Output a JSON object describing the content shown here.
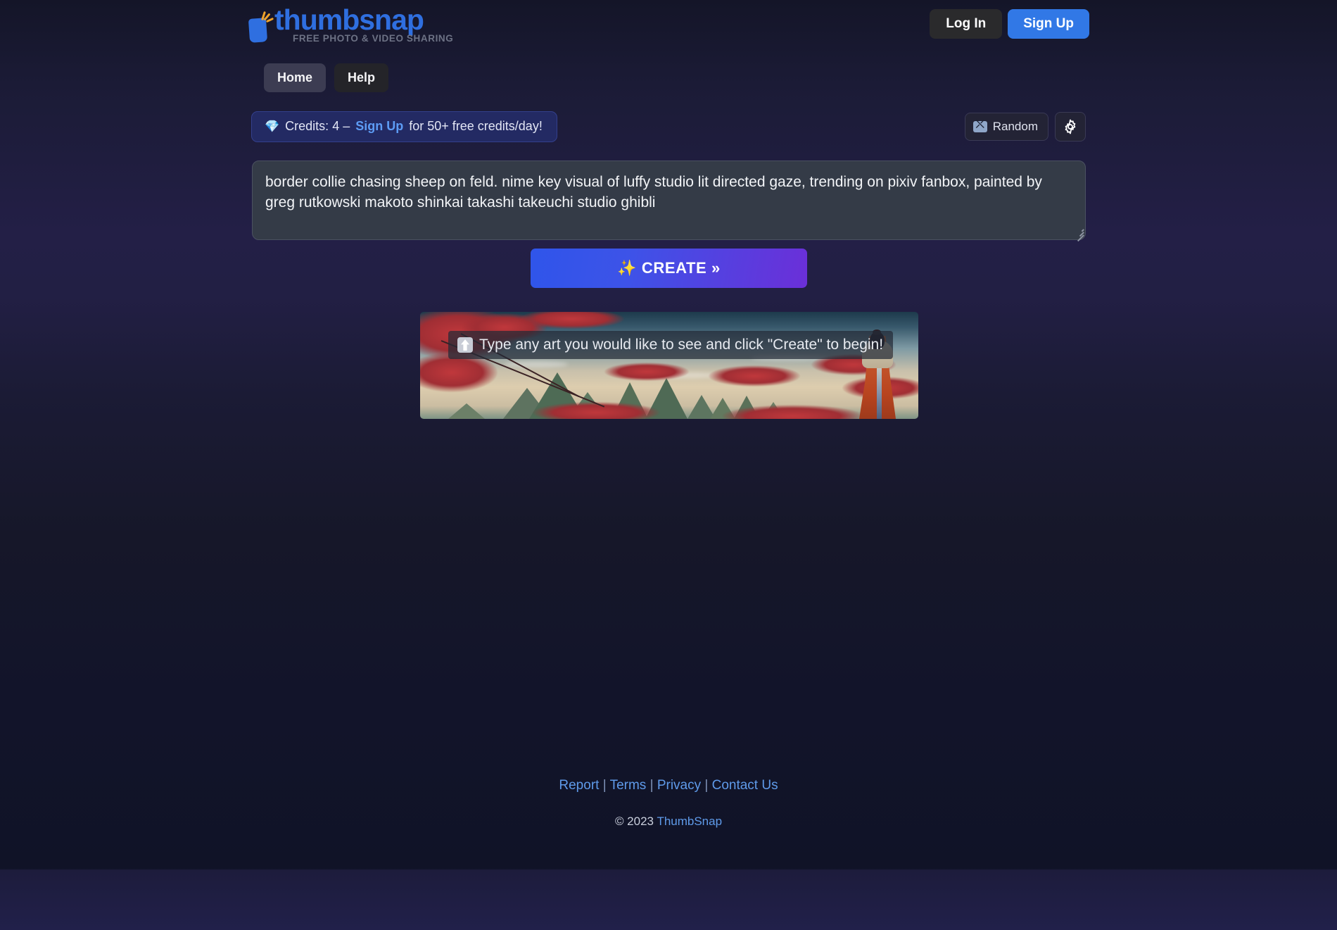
{
  "brand": {
    "name": "thumbsnap",
    "tagline": "FREE PHOTO & VIDEO SHARING",
    "logo_icon": "thumbsnap-logo-icon",
    "accent_blue": "#2f6fe0",
    "accent_orange": "#f0a32a"
  },
  "header": {
    "login_label": "Log In",
    "signup_label": "Sign Up"
  },
  "nav": {
    "items": [
      {
        "label": "Home",
        "active": true
      },
      {
        "label": "Help",
        "active": false
      }
    ]
  },
  "credits": {
    "gem_icon": "diamond-icon",
    "prefix": "Credits: 4 –",
    "signup_link": "Sign Up",
    "suffix": "for 50+ free credits/day!",
    "count": 4,
    "pill_bg": "#232a63",
    "link_color": "#5d9cf5"
  },
  "tools": {
    "random_label": "Random",
    "random_icon": "shuffle-icon",
    "settings_icon": "gear-icon"
  },
  "prompt": {
    "value": "border collie chasing sheep on feld. nime key visual of luffy studio lit directed gaze, trending on pixiv fanbox, painted by greg rutkowski makoto shinkai takashi takeuchi studio ghibli",
    "placeholder": "Type any art you would like to see and click \"Create\" to begin!"
  },
  "create": {
    "label": "✨ CREATE »",
    "gradient_from": "#2f55ea",
    "gradient_to": "#6b2fd8"
  },
  "hero": {
    "overlay_icon": "up-arrow-icon",
    "overlay_text": "Type any art you would like to see and click \"Create\" to begin!",
    "alt": "anime landscape with red maple trees, green mountains and a figure in an orange kimono"
  },
  "footer": {
    "links": [
      {
        "label": "Report"
      },
      {
        "label": "Terms"
      },
      {
        "label": "Privacy"
      },
      {
        "label": "Contact Us"
      }
    ],
    "separator": "|",
    "copyright_prefix": "© 2023",
    "copyright_brand": "ThumbSnap"
  }
}
